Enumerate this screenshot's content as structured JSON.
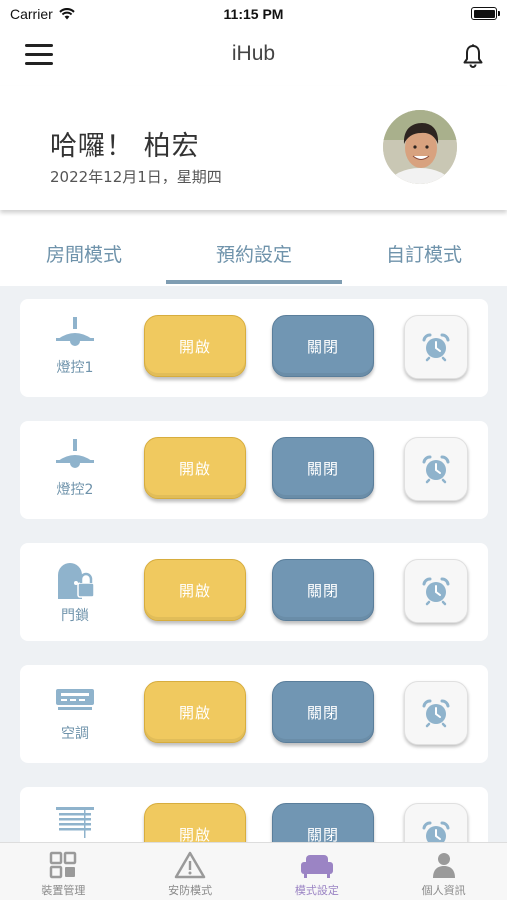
{
  "status_bar": {
    "carrier": "Carrier",
    "time": "11:15 PM"
  },
  "nav": {
    "title": "iHub"
  },
  "header": {
    "greeting": "哈囉！ 柏宏",
    "date": "2022年12月1日，星期四"
  },
  "tabs": [
    {
      "label": "房間模式",
      "active": false
    },
    {
      "label": "預約設定",
      "active": true
    },
    {
      "label": "自訂模式",
      "active": false
    }
  ],
  "devices": [
    {
      "label": "燈控1",
      "icon": "ceiling-lamp-icon",
      "on_label": "開啟",
      "off_label": "關閉"
    },
    {
      "label": "燈控2",
      "icon": "ceiling-lamp-icon",
      "on_label": "開啟",
      "off_label": "關閉"
    },
    {
      "label": "門鎖",
      "icon": "door-lock-icon",
      "on_label": "開啟",
      "off_label": "關閉"
    },
    {
      "label": "空調",
      "icon": "air-conditioner-icon",
      "on_label": "開啟",
      "off_label": "關閉"
    },
    {
      "label": "",
      "icon": "curtain-icon",
      "on_label": "開啟",
      "off_label": "關閉"
    }
  ],
  "bottom_nav": [
    {
      "label": "裝置管理",
      "icon": "device-grid-icon",
      "active": false
    },
    {
      "label": "安防模式",
      "icon": "warning-icon",
      "active": false
    },
    {
      "label": "模式設定",
      "icon": "sofa-icon",
      "active": true
    },
    {
      "label": "個人資訊",
      "icon": "person-icon",
      "active": false
    }
  ],
  "colors": {
    "accent": "#7196b3",
    "on_button": "#f0c95f",
    "off_button": "#7196b3",
    "tab_text": "#6f93ab",
    "active_bottom": "#9b84c4",
    "device_icon": "#8fb3cc"
  }
}
